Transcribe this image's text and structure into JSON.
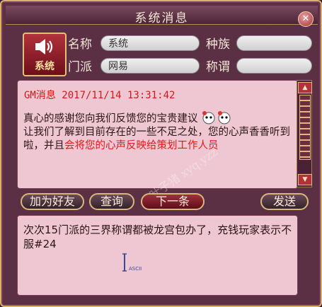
{
  "window": {
    "title": "系统消息",
    "close_label": "✕"
  },
  "sender": {
    "avatar_label": "系统",
    "name_label": "名称",
    "name_value": "系统",
    "race_label": "种族",
    "race_value": "",
    "sect_label": "门派",
    "sect_value": "网易",
    "title_label": "称谓",
    "title_value": ""
  },
  "message": {
    "header": "GM消息 2017/11/14 13:31:42",
    "part1": "真心的感谢您向我们反馈您的宝贵建议",
    "part2": "让我们了解到目前存在的一些不足之处，您的心声香香听到啦，并且",
    "part3": "会将您的心声反映给策划工作人员",
    "emoji_icon": "panda-faces-icon"
  },
  "buttons": {
    "add_friend": "加为好友",
    "query": "查询",
    "next": "下一条",
    "send": "发送"
  },
  "reply": {
    "text": "次次15门派的三界称谓都被龙宫包办了，充钱玩家表示不服#24",
    "cursor_label": "ASCII"
  },
  "watermark": {
    "text": "叶子猪 xyq.yzz"
  },
  "colors": {
    "accent": "#b1323c",
    "frame": "#5b3045",
    "highlight": "#e01a1a"
  }
}
